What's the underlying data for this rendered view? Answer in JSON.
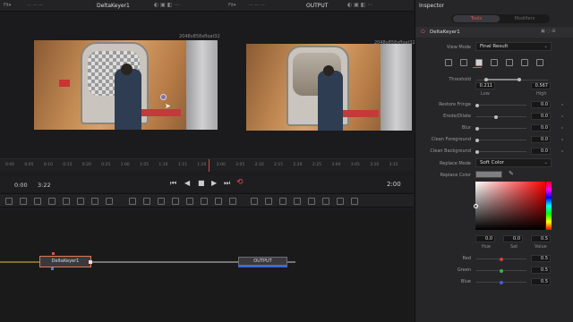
{
  "viewers": {
    "left": {
      "title": "DeltaKeyer1",
      "resolution": "2048x858xfloat32"
    },
    "right": {
      "title": "OUTPUT",
      "resolution": "2048x858xfloat32"
    }
  },
  "ruler_ticks": [
    "0:00",
    "0:05",
    "0:10",
    "0:15",
    "0:20",
    "0:25",
    "1:00",
    "1:05",
    "1:10",
    "1:15",
    "1:20",
    "2:00",
    "2:05",
    "2:10",
    "2:15",
    "2:20",
    "2:25",
    "3:00",
    "3:05",
    "3:10",
    "3:15"
  ],
  "transport": {
    "in_time": "0:00",
    "out_time": "3:22",
    "current_time": "2:00"
  },
  "nodes": {
    "keyer_label": "DeltaKeyer1",
    "output_label": "OUTPUT"
  },
  "inspector": {
    "title": "Inspector",
    "tabs": {
      "tools": "Tools",
      "modifiers": "Modifiers"
    },
    "node_name": "DeltaKeyer1",
    "view_mode_label": "View Mode",
    "view_mode_value": "Final Result",
    "threshold": {
      "label": "Threshold",
      "low": "0.211",
      "high": "0.567",
      "low_label": "Low",
      "high_label": "High"
    },
    "params": [
      {
        "label": "Restore Fringe",
        "value": "0.0"
      },
      {
        "label": "Erode/Dilate",
        "value": "0.0"
      },
      {
        "label": "Blur",
        "value": "0.0"
      },
      {
        "label": "Clean Foreground",
        "value": "0.0"
      },
      {
        "label": "Clean Background",
        "value": "0.0"
      }
    ],
    "replace_mode_label": "Replace Mode",
    "replace_mode_value": "Soft Color",
    "replace_color_label": "Replace Color",
    "hsv": {
      "hue": "0.0",
      "sat": "0.0",
      "value": "0.5",
      "hue_label": "Hue",
      "sat_label": "Sat",
      "value_label": "Value"
    },
    "rgb": [
      {
        "label": "Red",
        "value": "0.5",
        "color": "#d04040"
      },
      {
        "label": "Green",
        "value": "0.5",
        "color": "#40b040"
      },
      {
        "label": "Blue",
        "value": "0.5",
        "color": "#4060d0"
      }
    ]
  },
  "colors": {
    "accent": "#e64c4c",
    "playhead": "#d04a3a",
    "node_border": "#d97a52",
    "wire": "#e0c23a"
  }
}
